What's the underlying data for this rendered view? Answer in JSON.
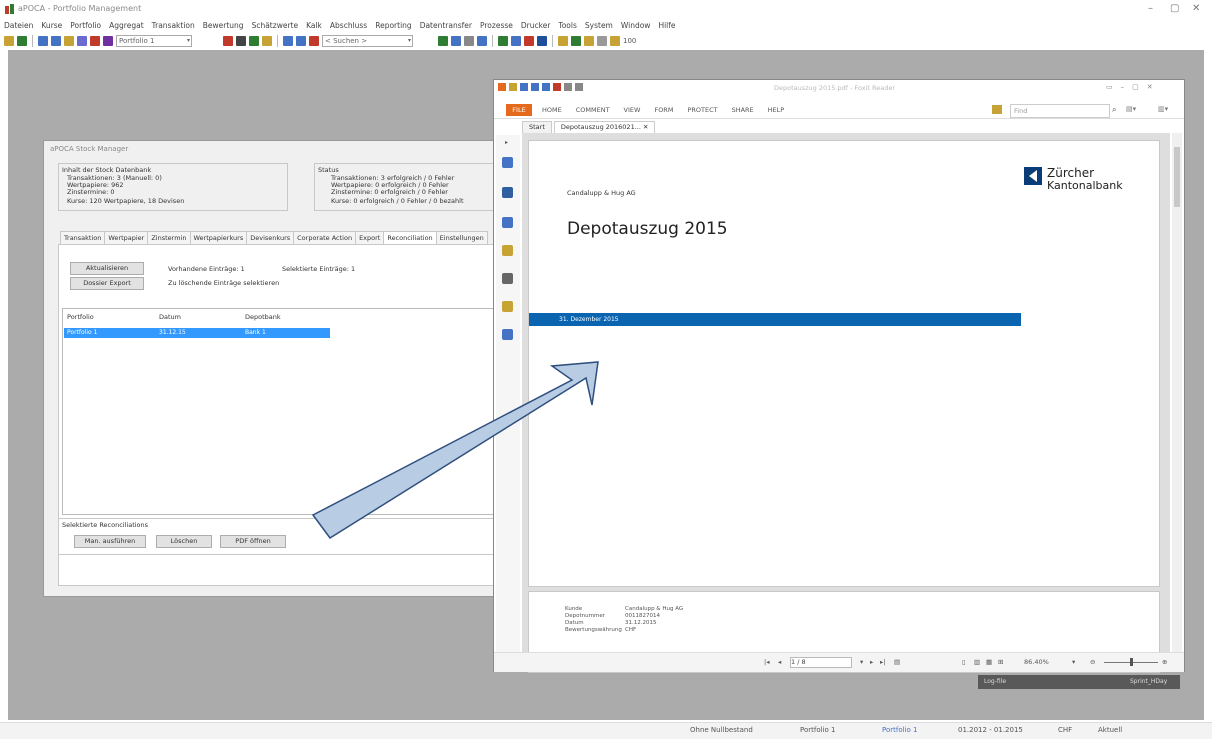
{
  "app": {
    "title": "aPOCA - Portfolio Management",
    "menu": [
      "Dateien",
      "Kurse",
      "Portfolio",
      "Aggregat",
      "Transaktion",
      "Bewertung",
      "Schätzwerte",
      "Kalk",
      "Abschluss",
      "Reporting",
      "Datentransfer",
      "Prozesse",
      "Drucker",
      "Tools",
      "System",
      "Window",
      "Hilfe"
    ],
    "toolbar": {
      "portfolio_combo": "Portfolio 1",
      "search_combo": "< Suchen >",
      "zoom_value": "100"
    },
    "window_controls": {
      "minimize": "–",
      "maximize": "▢",
      "close": "✕"
    }
  },
  "statusbar": {
    "items": [
      "Ohne Nullbestand",
      "Portfolio 1",
      "Portfolio 1",
      "01.2012 - 01.2015",
      "CHF",
      "Aktuell"
    ]
  },
  "stock_manager": {
    "title": "aPOCA Stock Manager",
    "db_group": {
      "title": "Inhalt der Stock Datenbank",
      "lines": [
        "Transaktionen: 3 (Manuell: 0)",
        "Wertpapiere: 962",
        "Zinstermine: 0",
        "Kurse: 120 Wertpapiere, 18 Devisen"
      ]
    },
    "status_group": {
      "title": "Status",
      "lines": [
        "Transaktionen: 3 erfolgreich / 0 Fehler",
        "Wertpapiere: 0 erfolgreich / 0 Fehler",
        "Zinstermine: 0 erfolgreich / 0 Fehler",
        "Kurse: 0 erfolgreich / 0 Fehler / 0 bezahlt"
      ]
    },
    "tabs": [
      "Transaktion",
      "Wertpapier",
      "Zinstermin",
      "Wertpapierkurs",
      "Devisenkurs",
      "Corporate Action",
      "Export",
      "Reconciliation",
      "Einstellungen"
    ],
    "active_tab": "Reconciliation",
    "buttons": {
      "refresh": "Aktualisieren",
      "dossier": "Dossier Export",
      "show": "Man. ausführen",
      "delete": "Löschen",
      "pdf": "PDF öffnen"
    },
    "info": {
      "existing": "Vorhandene Einträge: 1",
      "selected": "Selektierte Einträge: 1",
      "hint": "Zu löschende Einträge selektieren"
    },
    "grid": {
      "columns": [
        "Portfolio",
        "Datum",
        "Depotbank"
      ],
      "rows": [
        [
          "Portfolio 1",
          "31.12.15",
          "Bank 1"
        ]
      ]
    },
    "selected_group_title": "Selektierte Reconciliations"
  },
  "pdf_reader": {
    "title": "Depotauszug 2015.pdf - Foxit Reader",
    "file_tab": "FILE",
    "ribbon_tabs": [
      "HOME",
      "COMMENT",
      "VIEW",
      "FORM",
      "PROTECT",
      "SHARE",
      "HELP"
    ],
    "find_placeholder": "Find",
    "doc_tabs": [
      "Start",
      "Depotauszug 2016021..."
    ],
    "document": {
      "client": "Candalupp & Hug AG",
      "heading": "Depotauszug 2015",
      "date_band": "31. Dezember 2015",
      "bank_name_line1": "Zürcher",
      "bank_name_line2": "Kantonalbank",
      "meta": [
        [
          "Kunde",
          "Candalupp & Hug AG"
        ],
        [
          "Depotnummer",
          "0011827014"
        ],
        [
          "Datum",
          "31.12.2015"
        ],
        [
          "Bewertungswährung",
          "CHF"
        ]
      ]
    },
    "status": {
      "page": "1 / 8",
      "zoom": "86.40%"
    }
  },
  "float_panel": {
    "left": "Log-file",
    "right": "Sprint_HDay"
  },
  "colors": {
    "accent_blue": "#3399ff",
    "band_blue": "#0a64b0",
    "file_orange": "#e66a1e",
    "workspace_gray": "#ababab",
    "arrow_fill": "#b8cce4",
    "arrow_stroke": "#2f4f7f"
  }
}
